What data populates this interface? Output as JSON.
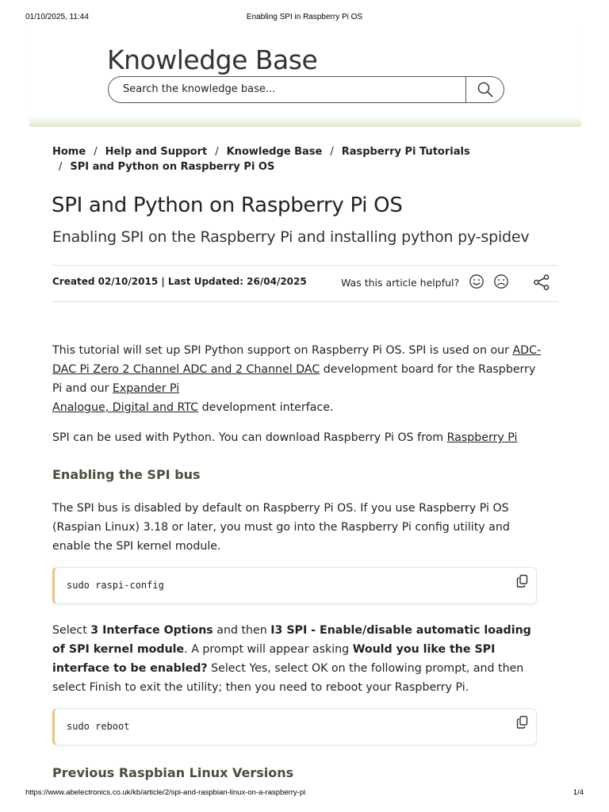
{
  "print": {
    "datetime": "01/10/2025, 11:44",
    "title": "Enabling SPI in Raspberry Pi OS",
    "url": "https://www.abelectronics.co.uk/kb/article/2/spi-and-raspbian-linux-on-a-raspberry-pi",
    "page": "1/4"
  },
  "header": {
    "title": "Knowledge Base",
    "search_placeholder": "Search the knowledge base..."
  },
  "breadcrumb": {
    "items": [
      "Home",
      "Help and Support",
      "Knowledge Base",
      "Raspberry Pi Tutorials",
      "SPI and Python on Raspberry Pi OS"
    ],
    "separator": "/"
  },
  "article": {
    "title": "SPI and Python on Raspberry Pi OS",
    "subtitle": "Enabling SPI on the Raspberry Pi and installing python py-spidev",
    "dates": "Created 02/10/2015 | Last Updated: 26/04/2025",
    "helpful_label": "Was this article helpful?",
    "p1": {
      "t1": "This tutorial will set up SPI Python support on Raspberry Pi OS. SPI is used on our ",
      "link1": "ADC-DAC Pi Zero 2 Channel ADC and 2 Channel DAC",
      "t2": " development board for the Raspberry Pi and our ",
      "link2a": "Expander Pi",
      "link2b": "Analogue, Digital and RTC",
      "t3": " development interface."
    },
    "p2": {
      "t1": "SPI can be used with Python. You can download Raspberry Pi OS from ",
      "link": "Raspberry Pi"
    },
    "h2a": "Enabling the SPI bus",
    "p3": "The SPI bus is disabled by default on Raspberry Pi OS. If you use Raspberry Pi OS (Raspian Linux) 3.18 or later, you must go into the Raspberry Pi config utility and enable the SPI kernel module.",
    "code1": "sudo raspi-config",
    "p4": {
      "t1": "Select ",
      "b1": "3 Interface Options",
      "t2": " and then  ",
      "b2": "I3 SPI - Enable/disable automatic loading of SPI kernel module",
      "t3": ". A prompt will appear asking ",
      "b3": "Would you like the SPI interface to be enabled?",
      "t4": " Select Yes, select OK on the following prompt, and then select Finish to exit the utility; then you need to reboot your Raspberry Pi."
    },
    "code2": "sudo reboot",
    "h2b": "Previous Raspbian Linux Versions"
  }
}
